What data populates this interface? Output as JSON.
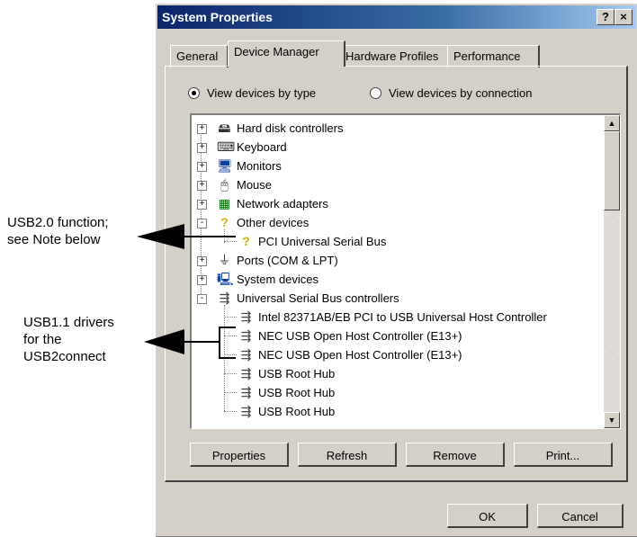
{
  "annotations": {
    "usb20": [
      "USB2.0 function;",
      "see Note below"
    ],
    "usb11": [
      "USB1.1 drivers",
      "for the",
      "USB2connect"
    ]
  },
  "window": {
    "title": "System Properties",
    "help_label": "?",
    "close_label": "×"
  },
  "tabs": [
    {
      "label": "General"
    },
    {
      "label": "Device Manager"
    },
    {
      "label": "Hardware Profiles"
    },
    {
      "label": "Performance"
    }
  ],
  "view_options": {
    "by_type": "View devices by type",
    "by_connection": "View devices by connection",
    "selected": "by_type"
  },
  "tree": [
    {
      "label": "Hard disk controllers",
      "icon": "disk-controller-icon"
    },
    {
      "label": "Keyboard",
      "icon": "keyboard-icon"
    },
    {
      "label": "Monitors",
      "icon": "monitor-icon"
    },
    {
      "label": "Mouse",
      "icon": "mouse-icon"
    },
    {
      "label": "Network adapters",
      "icon": "network-adapter-icon"
    },
    {
      "label": "Other devices",
      "icon": "question-mark-icon"
    },
    {
      "label": "PCI Universal Serial Bus",
      "icon": "unknown-device-icon"
    },
    {
      "label": "Ports (COM & LPT)",
      "icon": "port-icon"
    },
    {
      "label": "System devices",
      "icon": "system-device-icon"
    },
    {
      "label": "Universal Serial Bus controllers",
      "icon": "usb-icon"
    },
    {
      "label": "Intel 82371AB/EB PCI to USB Universal Host Controller",
      "icon": "usb-icon"
    },
    {
      "label": "NEC USB Open Host Controller (E13+)",
      "icon": "usb-icon"
    },
    {
      "label": "NEC USB Open Host Controller (E13+)",
      "icon": "usb-icon"
    },
    {
      "label": "USB Root Hub",
      "icon": "usb-icon"
    },
    {
      "label": "USB Root Hub",
      "icon": "usb-icon"
    },
    {
      "label": "USB Root Hub",
      "icon": "usb-icon"
    }
  ],
  "buttons": {
    "properties": "Properties",
    "refresh": "Refresh",
    "remove": "Remove",
    "print": "Print...",
    "ok": "OK",
    "cancel": "Cancel"
  }
}
